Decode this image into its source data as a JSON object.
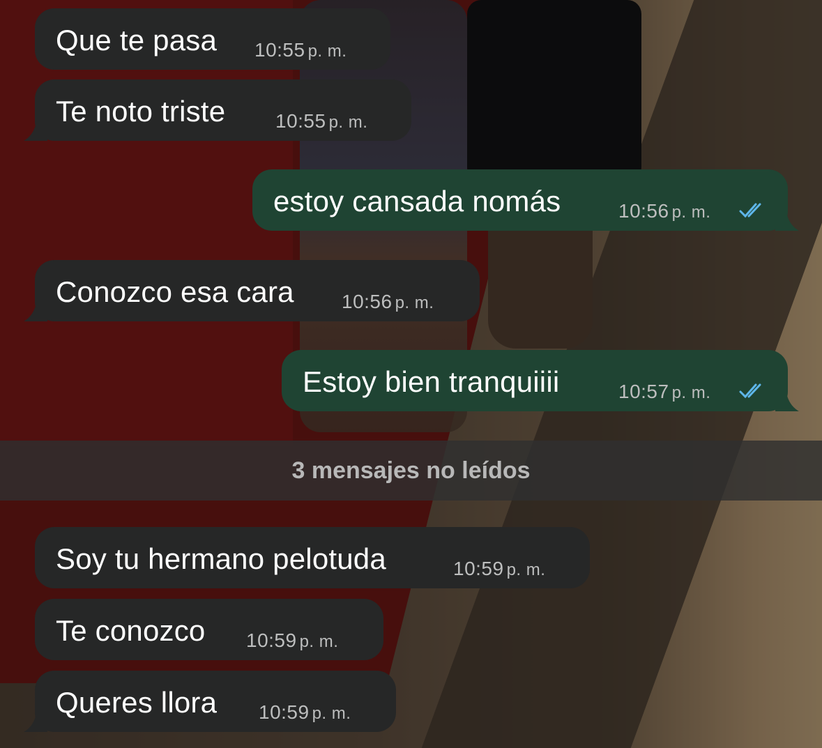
{
  "conversation": {
    "messages": [
      {
        "direction": "incoming",
        "text": "Que te pasa",
        "time": "10:55",
        "ampm": "p. m."
      },
      {
        "direction": "incoming",
        "text": "Te noto triste",
        "time": "10:55",
        "ampm": "p. m."
      },
      {
        "direction": "outgoing",
        "text": "estoy cansada nomás",
        "time": "10:56",
        "ampm": "p. m.",
        "status": "read"
      },
      {
        "direction": "incoming",
        "text": "Conozco esa cara",
        "time": "10:56",
        "ampm": "p. m."
      },
      {
        "direction": "outgoing",
        "text": "Estoy bien tranquiiii",
        "time": "10:57",
        "ampm": "p. m.",
        "status": "read"
      },
      {
        "direction": "incoming",
        "text": "Soy tu hermano pelotuda",
        "time": "10:59",
        "ampm": "p. m."
      },
      {
        "direction": "incoming",
        "text": "Te conozco",
        "time": "10:59",
        "ampm": "p. m."
      },
      {
        "direction": "incoming",
        "text": "Queres llora",
        "time": "10:59",
        "ampm": "p. m."
      }
    ],
    "unread_divider": "3 mensajes no leídos"
  },
  "colors": {
    "incoming_bubble": "#262727",
    "outgoing_bubble": "#1f4433",
    "read_ticks": "#5eb6ea",
    "timestamp": "#bdbebe"
  },
  "icons": {
    "read_status": "double-check-icon"
  }
}
